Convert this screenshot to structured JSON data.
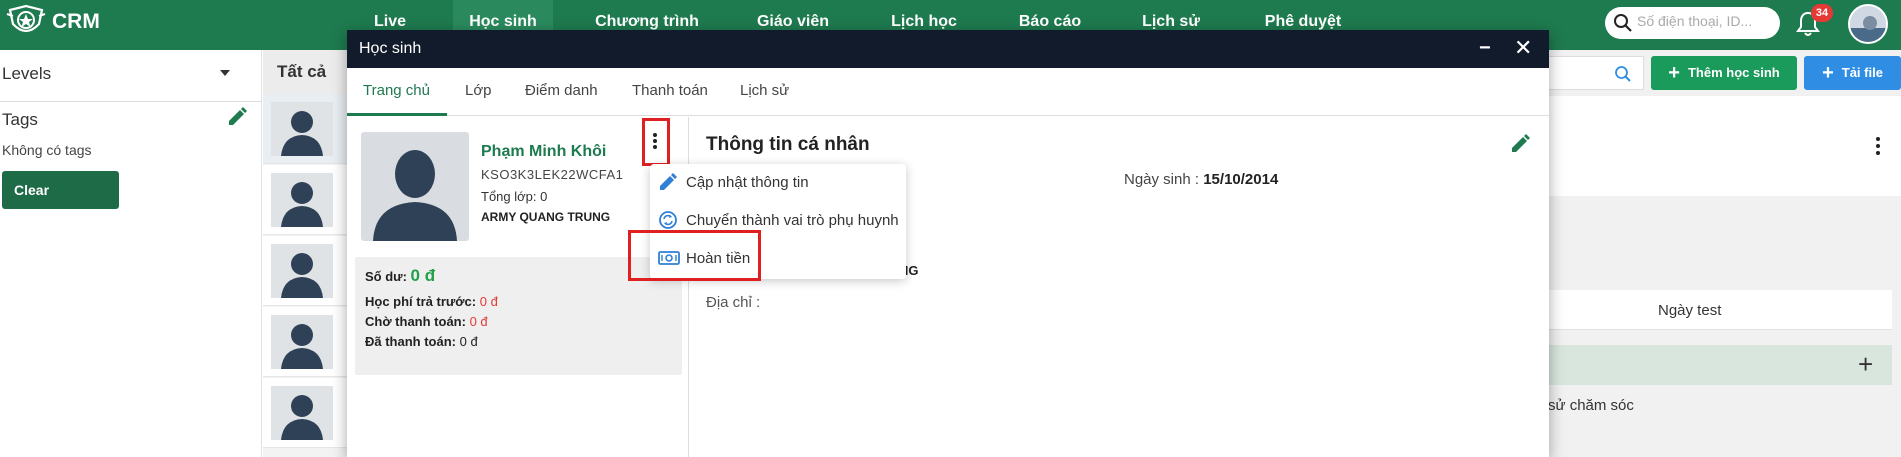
{
  "app": {
    "logo_text": "CRM"
  },
  "topnav": {
    "items": [
      {
        "label": "Live"
      },
      {
        "label": "Học sinh"
      },
      {
        "label": "Chương trình"
      },
      {
        "label": "Giáo viên"
      },
      {
        "label": "Lịch học"
      },
      {
        "label": "Báo cáo"
      },
      {
        "label": "Lịch sử"
      },
      {
        "label": "Phê duyệt"
      }
    ],
    "active_index": 1,
    "search_placeholder": "Số điện thoại, ID...",
    "notification_count": "34"
  },
  "sidebar": {
    "levels_label": "Levels",
    "tags_label": "Tags",
    "no_tags_text": "Không có tags",
    "clear_label": "Clear"
  },
  "list": {
    "header_partial": "Tất cả"
  },
  "background": {
    "add_student_label": "Thêm học sinh",
    "upload_label": "Tải file",
    "ngay_test_label": "Ngày test",
    "care_history_partial": "sử chăm sóc"
  },
  "modal": {
    "title": "Học sinh",
    "tabs": [
      {
        "label": "Trang chủ"
      },
      {
        "label": "Lớp"
      },
      {
        "label": "Điểm danh"
      },
      {
        "label": "Thanh toán"
      },
      {
        "label": "Lịch sử"
      }
    ],
    "active_tab_index": 0,
    "student": {
      "name": "Phạm Minh Khôi",
      "code": "KSO3K3LEK22WCFA1",
      "total_classes": "Tổng lớp: 0",
      "branch": "ARMY QUANG TRUNG"
    },
    "balance": {
      "balance_label": "Số dư:",
      "balance_value": "0 đ",
      "prepaid_label": "Học phí trả trước:",
      "prepaid_value": "0 đ",
      "pending_label": "Chờ thanh toán:",
      "pending_value": "0 đ",
      "paid_label": "Đã thanh toán:",
      "paid_value": "0 đ"
    },
    "info": {
      "title": "Thông tin cá nhân",
      "dob_label": "Ngày sinh :",
      "dob_value": "15/10/2014",
      "branch_partial": "NG",
      "address_label": "Địa chỉ :"
    },
    "menu": [
      {
        "label": "Cập nhật thông tin",
        "icon": "pencil-icon"
      },
      {
        "label": "Chuyển thành vai trò phụ huynh",
        "icon": "switch-role-icon"
      },
      {
        "label": "Hoàn tiền",
        "icon": "refund-money-icon"
      }
    ]
  },
  "colors": {
    "brand_green": "#1e7a4f",
    "modal_header": "#121b2b",
    "highlight_red": "#e02020",
    "money_red": "#e53935",
    "money_green": "#22a048",
    "upload_blue": "#2f8de4",
    "add_green": "#1a9b5b"
  }
}
